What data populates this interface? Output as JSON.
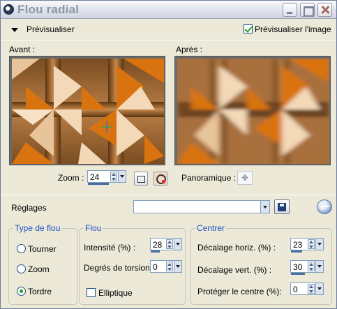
{
  "window": {
    "title": "Flou radial"
  },
  "header": {
    "preview_toggle_label": "Prévisualiser",
    "preview_checkbox_label": "Prévisualiser l'image",
    "preview_checked": true
  },
  "preview": {
    "before_label": "Avant :",
    "after_label": "Après :"
  },
  "zoom": {
    "label": "Zoom :",
    "value": "24",
    "pan_label": "Panoramique :"
  },
  "presets": {
    "label": "Réglages",
    "value": ""
  },
  "blur_type": {
    "title": "Type de flou",
    "options": [
      {
        "label": "Tourner",
        "checked": false
      },
      {
        "label": "Zoom",
        "checked": false
      },
      {
        "label": "Tordre",
        "checked": true
      }
    ]
  },
  "blur": {
    "title": "Flou",
    "intensity_label": "Intensité (%) :",
    "intensity_value": "28",
    "twist_label": "Degrés de torsion :",
    "twist_value": "0",
    "elliptical_label": "Elliptique",
    "elliptical_checked": false
  },
  "center": {
    "title": "Centrer",
    "h_offset_label": "Décalage horiz. (%) :",
    "h_offset_value": "23",
    "v_offset_label": "Décalage vert. (%) :",
    "v_offset_value": "30",
    "protect_label": "Protéger le centre (%):",
    "protect_value": "0"
  },
  "colors": {
    "title_text": "#8d95a5",
    "group_title": "#1d52c4",
    "pattern_dark": "#5a3410",
    "pattern_orange": "#d9730f",
    "pattern_light": "#f3d9b8"
  }
}
